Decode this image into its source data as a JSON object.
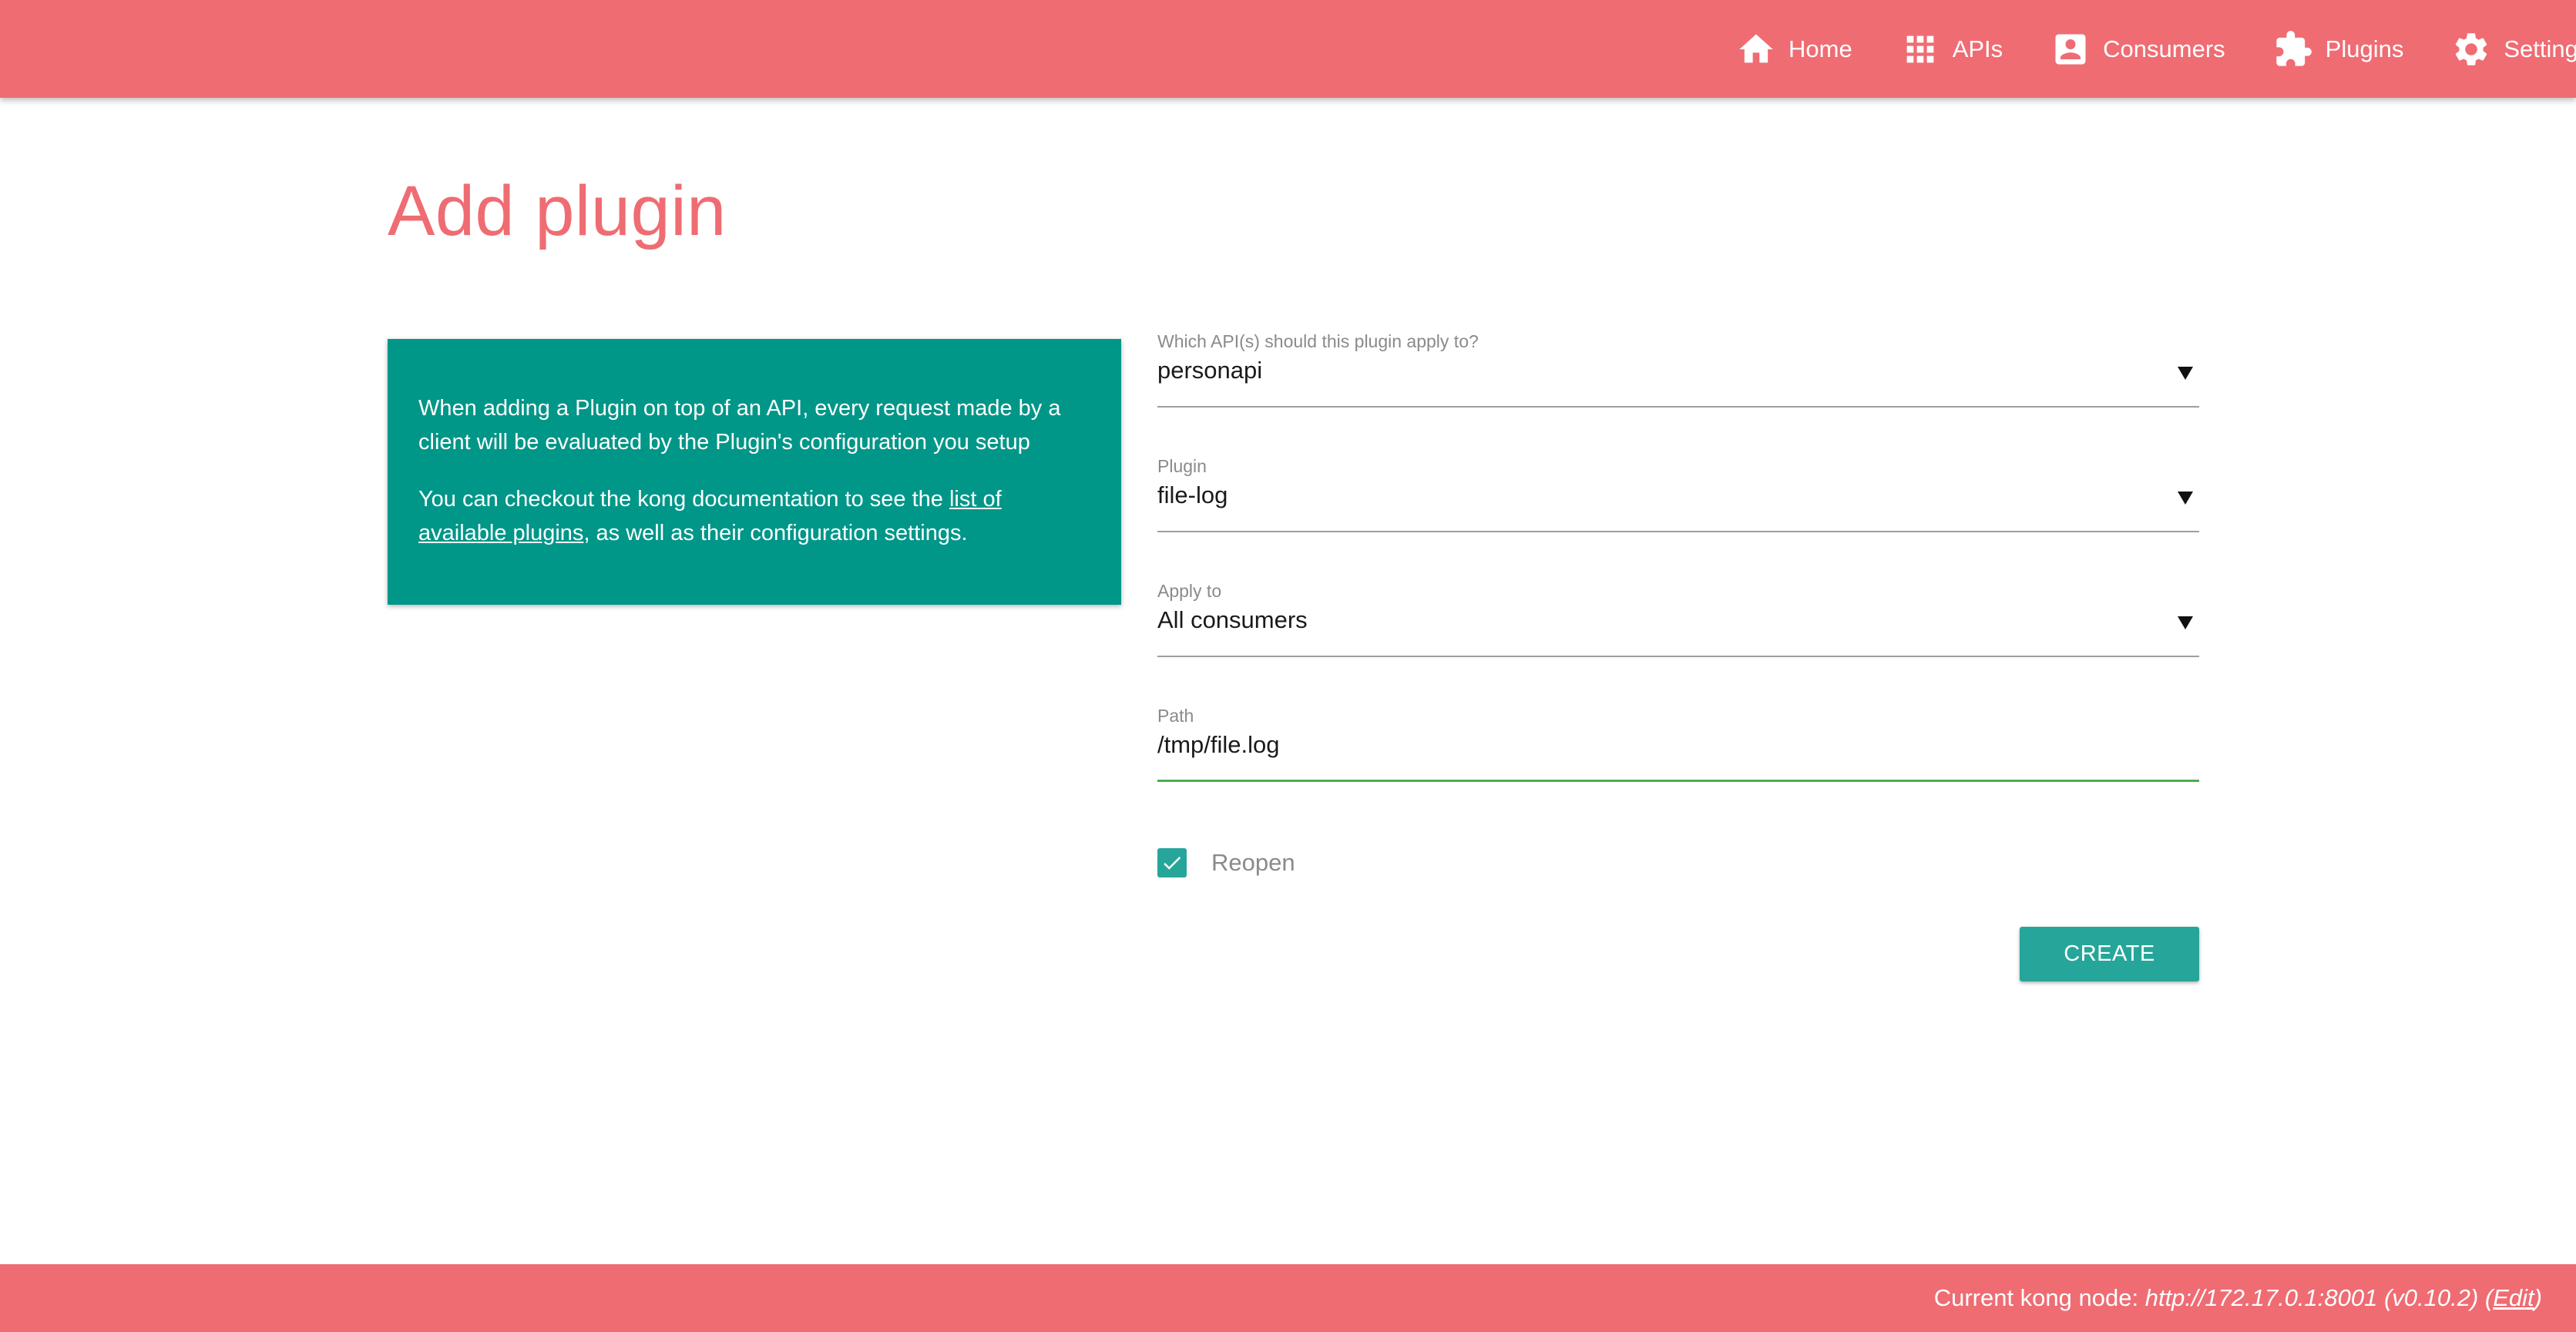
{
  "nav": {
    "items": [
      {
        "label": "Home",
        "icon": "home-icon"
      },
      {
        "label": "APIs",
        "icon": "grid-icon"
      },
      {
        "label": "Consumers",
        "icon": "account-box-icon"
      },
      {
        "label": "Plugins",
        "icon": "puzzle-icon"
      },
      {
        "label": "Settings",
        "icon": "gear-icon"
      }
    ]
  },
  "page": {
    "title": "Add plugin"
  },
  "info": {
    "p1": "When adding a Plugin on top of an API, every request made by a client will be evaluated by the Plugin's configuration you setup",
    "p2_before": "You can checkout the kong documentation to see the ",
    "p2_link": "list of available plugins",
    "p2_after": ", as well as their configuration settings."
  },
  "form": {
    "api": {
      "label": "Which API(s) should this plugin apply to?",
      "value": "personapi"
    },
    "plugin": {
      "label": "Plugin",
      "value": "file-log"
    },
    "apply_to": {
      "label": "Apply to",
      "value": "All consumers"
    },
    "path": {
      "label": "Path",
      "value": "/tmp/file.log"
    },
    "reopen": {
      "label": "Reopen",
      "checked": true
    },
    "create_label": "CREATE"
  },
  "footer": {
    "prefix": "Current kong node: ",
    "node": "http://172.17.0.1:8001 (v0.10.2)",
    "open_paren": " (",
    "edit": "Edit",
    "close_paren": ")"
  },
  "colors": {
    "header": "#ef6c73",
    "card": "#009688",
    "accent": "#26a69a",
    "focus_underline": "#4caf50"
  }
}
